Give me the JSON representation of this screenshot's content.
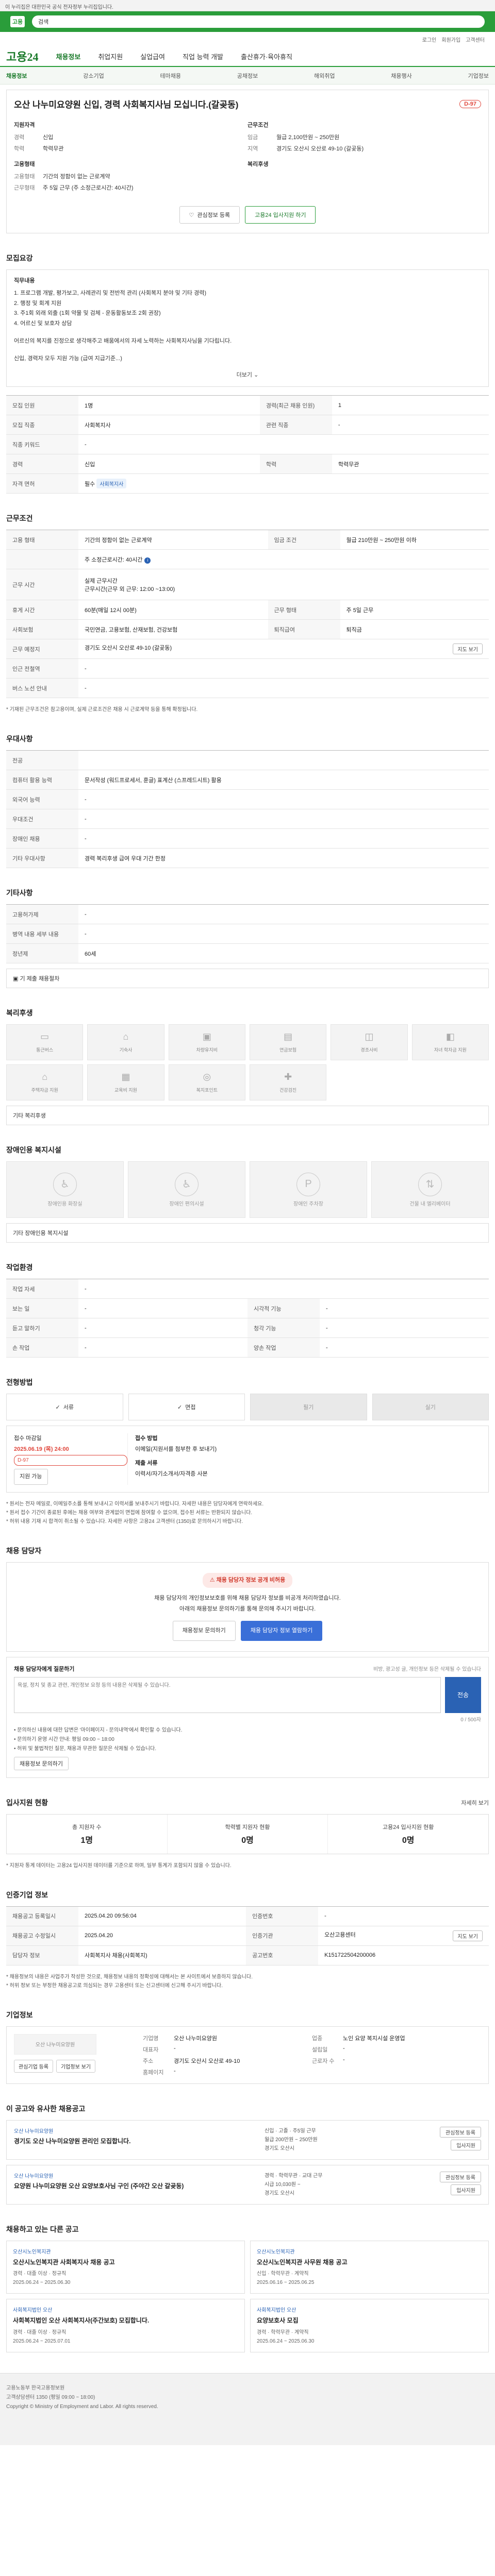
{
  "top_notice": "이 누리집은 대한민국 공식 전자정부 누리집입니다.",
  "gov_search": {
    "logo_text": "고용",
    "value": "검색"
  },
  "util_links": [
    "로그인",
    "회원가입",
    "고객센터"
  ],
  "brand": "고용24",
  "main_nav": [
    "채용정보",
    "취업지원",
    "실업급여",
    "직업 능력 개발",
    "출산휴가·육아휴직"
  ],
  "sub_nav": [
    "채용정보",
    "강소기업",
    "테마채용",
    "공채정보",
    "해외취업",
    "채용행사",
    "기업정보"
  ],
  "job": {
    "title": "오산 나누미요양원 신입, 경력 사회복지사님 모십니다.(갈곶동)",
    "dday": "D-97",
    "summary_left_label": "지원자격",
    "summary_left": [
      {
        "k": "경력",
        "v": "신입"
      },
      {
        "k": "학력",
        "v": "학력무관"
      }
    ],
    "summary_left_label2": "고용형태",
    "summary_left2": [
      {
        "k": "고용형태",
        "v": "기간의 정함이 없는 근로계약"
      },
      {
        "k": "근무형태",
        "v": "주 5일 근무 (주 소정근로시간: 40시간)"
      }
    ],
    "summary_right_label": "근무조건",
    "summary_right": [
      {
        "k": "임금",
        "v": "월급 2,100만원 ~ 250만원"
      },
      {
        "k": "지역",
        "v": "경기도 오산시 오산로 49-10 (갈곶동)"
      }
    ],
    "summary_right_label2": "복리후생",
    "btn_scrap": "관심정보 등록",
    "btn_homepage": "고용24 입사지원 하기"
  },
  "sections": {
    "recruit": "모집요강",
    "work": "근무조건",
    "welfare_note": "우대사항",
    "other": "기타사항",
    "benefits": "복리후생",
    "disability": "장애인용 복지시설",
    "apply": "전형방법",
    "contact": "채용 담당자",
    "status": "입사지원 현황",
    "manager": "인증기업 정보",
    "company": "기업정보",
    "recommend": "이 공고와 유사한 채용공고",
    "others": "채용하고 있는 다른 공고"
  },
  "recruit_box": {
    "hd": "직무내용",
    "lines": [
      "1. 프로그램 개발, 평가보고, 사례관리 및 전반적 관리 (사회복지 분야 및 기타 경력)",
      "2. 행정 및 회계 지원",
      "3. 주1회 외래 외출 (1회 약물 및 검체 - 운동활동보조 2회 권장)",
      "4. 어르신 및 보호자 상담",
      "",
      "어르신의 복지를 진정으로 생각해주고 배움에서의 자세 노력하는 사회복지사님을 기다립니다.",
      "",
      "신입, 경력자 모두 지원 가능 (급여 지급기준...)"
    ],
    "more": "더보기"
  },
  "recruit_table": [
    {
      "th": "모집 인원",
      "td": "1명",
      "th2": "경력(최근 채용 인원)",
      "td2": "1"
    },
    {
      "th": "모집 직종",
      "td": "사회복지사",
      "th2": "관련 직종",
      "td2": "-"
    },
    {
      "th": "직종 키워드",
      "td": "-",
      "th2": "",
      "td2": ""
    },
    {
      "th": "경력",
      "td": "신입",
      "th2": "학력",
      "td2": "학력무관"
    },
    {
      "th": "자격 면허",
      "td": "필수",
      "td_chip": "사회복지사",
      "th2": "",
      "td2": ""
    }
  ],
  "work_table": [
    {
      "th": "고용 형태",
      "td": "기간의 정함이 없는 근로계약",
      "th2": "임금 조건",
      "td2": "월급 210만원 ~ 250만원 이하"
    },
    {
      "th": "",
      "td": "주 소정근로시간: 40시간",
      "th2": "",
      "td2": ""
    },
    {
      "th": "근무 시간",
      "td": "실제 근무시간\n근무시간(근무 외 근무: 12:00 ~13:00)",
      "th2": "",
      "td2": ""
    },
    {
      "th": "휴게 시간",
      "td": "60분(매일 12시 00분)",
      "th2": "근무 형태",
      "td2": "주 5일 근무"
    },
    {
      "th": "사회보험",
      "td": "국민연금, 고용보험, 산재보험, 건강보험",
      "th2": "퇴직급여",
      "td2": "퇴직금"
    },
    {
      "th": "근무 예정지",
      "td": "경기도 오산시 오산로 49-10 (갈곶동)",
      "th2": "",
      "td2": "",
      "pill": "지도 보기"
    },
    {
      "th": "인근 전철역",
      "td": "-",
      "th2": "",
      "td2": ""
    },
    {
      "th": "버스 노선 안내",
      "td": "-",
      "th2": "",
      "td2": ""
    }
  ],
  "work_note": "* 기재된 근무조건은 참고용이며, 실제 근로조건은 채용 시 근로계약 등을 통해 확정됩니다.",
  "welfare_table": [
    {
      "th": "전공",
      "td": ""
    },
    {
      "th": "컴퓨터 활용 능력",
      "td": "문서작성 (워드프로세서, 훈글) 표계산 (스프레드시트) 활용"
    },
    {
      "th": "외국어 능력",
      "td": "-"
    },
    {
      "th": "우대조건",
      "td": "-"
    },
    {
      "th": "장애인 채용",
      "td": "-"
    },
    {
      "th": "기타 우대사항",
      "td": "경력 복리후생 급여 우대 기간 한정"
    }
  ],
  "other_table": [
    {
      "th": "고용허가제",
      "td": "-"
    },
    {
      "th": "병역 내용 세부 내용",
      "td": "-"
    },
    {
      "th": "정년제",
      "td": "60세"
    }
  ],
  "other_more": "기 제출 채용절차",
  "benefits_grid": [
    "통근버스",
    "기숙사",
    "차량유지비",
    "연금보험",
    "경조사비",
    "자녀 학자금 지원",
    "주택자금 지원",
    "교육비 지원",
    "복지포인트",
    "건강검진"
  ],
  "benefits_extra": "기타 복리후생",
  "disability_grid": [
    "장애인용 화장실",
    "장애인 편의시설",
    "장애인 주차장",
    "건물 내 엘리베이터"
  ],
  "disability_extra": "기타 장애인용 복지시설",
  "env_table": [
    {
      "th": "작업 자세",
      "td": "-",
      "th2": "",
      "td2": ""
    },
    {
      "th": "보는 일",
      "td": "-",
      "th2": "시각적 기능",
      "td2": "-"
    },
    {
      "th": "듣고 말하기",
      "td": "-",
      "th2": "청각 기능",
      "td2": "-"
    },
    {
      "th": "손 작업",
      "td": "-",
      "th2": "양손 작업",
      "td2": "-"
    }
  ],
  "env_title": "작업환경",
  "method_items": [
    "서류",
    "면접",
    "필기",
    "실기"
  ],
  "apply_box": {
    "label": "접수 마감일",
    "period": "2025.06.19 (목) 24:00",
    "dday": "D-97",
    "status_btn": "지원 가능",
    "methods_label": "접수 방법",
    "methods": "이메일(지원서를 첨부한 후 보내기)",
    "submit_label": "제출 서류",
    "submit": "이력서/자기소개서/자격증 사본"
  },
  "notes": [
    "* 원서는 전자 메일로, 이메일주소를 통해 보내시고 이력서를 보내주시기 바랍니다. 자세한 내용은 담당자에게 연락하세요.",
    "* 원서 접수 기간이 종료된 후에는 채용 여부와 관계없이 면접에 참여할 수 없으며, 접수된 서류는 반환되지 않습니다.",
    "* 허위 내용 기재 시 합격이 취소될 수 있습니다. 자세한 사항은 고용24 고객센터 (1350)로 문의하시기 바랍니다."
  ],
  "contact": {
    "badge": "채용 담당자 정보 공개 비허용",
    "line1": "채용 담당자의 개인정보보호를 위해 채용 담당자 정보를 비공개 처리하였습니다.",
    "line2": "아래의 채용정보 문의하기를 통해 문의해 주시기 바랍니다.",
    "btn1": "채용정보 문의하기",
    "btn2": "채용 담당자 정보 열람하기"
  },
  "ask": {
    "title": "채용 담당자에게 질문하기",
    "hint": "비방, 광고성 글, 개인정보 등은 삭제될 수 있습니다",
    "placeholder": "욕설, 정치 및 종교 관련, 개인정보 요청 등의 내용은 삭제될 수 있습니다.",
    "counter": "0 / 500자",
    "submit": "전송",
    "bullets": [
      "• 문의하신 내용에 대한 답변은 '마이페이지 - 문의내역'에서 확인할 수 있습니다.",
      "• 문의하기 운영 시간 안내: 평일 09:00 ~ 18:00",
      "• 허위 및 불법적인 질문, 채용과 무관한 질문은 삭제될 수 있습니다."
    ],
    "more_btn": "채용정보 문의하기"
  },
  "status": {
    "more": "자세히 보기",
    "cells": [
      {
        "lbl": "총 지원자 수",
        "val": "1명"
      },
      {
        "lbl": "학력별 지원자 현황",
        "val": "0명"
      },
      {
        "lbl": "고용24 입사지원 현황",
        "val": "0명"
      }
    ],
    "note": "* 지원자 통계 데이터는 고용24 입사지원 데이터를 기준으로 하며, 일부 통계가 포함되지 않을 수 있습니다."
  },
  "manager_table": [
    {
      "th": "채용공고 등록일시",
      "td": "2025.04.20 09:56:04",
      "th2": "인증번호",
      "td2": "-"
    },
    {
      "th": "채용공고 수정일시",
      "td": "2025.04.20",
      "th2": "인증기관",
      "td2": "오산고용센터",
      "pill": "지도 보기"
    },
    {
      "th": "담당자 정보",
      "td": "사회복지사 채용(사회복지)",
      "th2": "공고번호",
      "td2": "K151722504200006"
    }
  ],
  "manager_notes": [
    "* 채용정보의 내용은 사업주가 작성한 것으로, 채용정보 내용의 정확성에 대해서는 본 사이트에서 보증하지 않습니다.",
    "* 허위 정보 또는 부정한 채용공고로 의심되는 경우 고용센터 또는 신고센터에 신고해 주시기 바랍니다."
  ],
  "company": {
    "logo": "오산 나누미요양원",
    "rows": [
      {
        "k": "기업명",
        "v": "오산 나누미요양원",
        "k2": "업종",
        "v2": "노인 요양 복지시설 운영업"
      },
      {
        "k": "대표자",
        "v": "-",
        "k2": "설립일",
        "v2": "-"
      },
      {
        "k": "주소",
        "v": "경기도 오산시 오산로 49-10",
        "k2": "근로자 수",
        "v2": "-"
      },
      {
        "k": "홈페이지",
        "v": "-",
        "k2": "",
        "v2": ""
      }
    ],
    "btn1": "관심기업 등록",
    "btn2": "기업정보 보기"
  },
  "recommend": [
    {
      "company": "오산 나누미요양원",
      "title": "경기도 오산 나누미요양원 관리인 모집합니다.",
      "meta1": "신입 · 고졸 · 주5일 근무",
      "meta2": "월급 200만원 ~ 250만원",
      "meta3": "경기도 오산시",
      "b1": "관심정보 등록",
      "b2": "입사지원"
    },
    {
      "company": "오산 나누미요양원",
      "title": "요양원 나누미요양원 오산 요양보호사님 구인 (주야간 오산 갈곶동)",
      "meta1": "경력 · 학력무관 · 교대 근무",
      "meta2": "시급 10,030원 ~",
      "meta3": "경기도 오산시",
      "b1": "관심정보 등록",
      "b2": "입사지원"
    }
  ],
  "others": [
    {
      "company": "오산시노인복지관",
      "title": "오산시노인복지관 사회복지사 채용 공고",
      "meta": "경력 · 대졸 이상 · 정규직\n2025.06.24 ~ 2025.06.30"
    },
    {
      "company": "오산시노인복지관",
      "title": "오산시노인복지관 사무원 채용 공고",
      "meta": "신입 · 학력무관 · 계약직\n2025.06.16 ~ 2025.06.25"
    },
    {
      "company": "사회복지법인 오산",
      "title": "사회복지법인 오산 사회복지사(주간보호) 모집합니다.",
      "meta": "경력 · 대졸 이상 · 정규직\n2025.06.24 ~ 2025.07.01"
    },
    {
      "company": "사회복지법인 오산",
      "title": "요양보호사 모집",
      "meta": "경력 · 학력무관 · 계약직\n2025.06.24 ~ 2025.06.30"
    }
  ],
  "footer": {
    "line1": "고용노동부 한국고용정보원",
    "line2": "고객상담센터 1350 (평일 09:00 ~ 18:00)",
    "line3": "Copyright © Ministry of Employment and Labor. All rights reserved."
  }
}
